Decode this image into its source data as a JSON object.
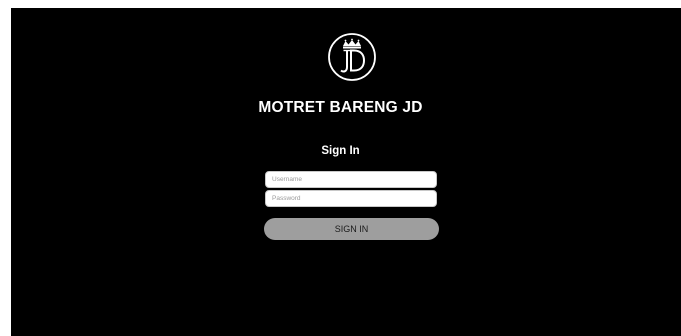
{
  "brand": {
    "logo_icon": "jd-crown-monogram-logo",
    "logo_text": "JD",
    "title": "MOTRET BARENG JD"
  },
  "login": {
    "heading": "Sign In",
    "username": {
      "value": "",
      "placeholder": "Username"
    },
    "password": {
      "value": "",
      "placeholder": "Password"
    },
    "submit_label": "SIGN IN"
  },
  "colors": {
    "page_background": "#000000",
    "button_background": "#9e9e9e",
    "text": "#ffffff"
  }
}
